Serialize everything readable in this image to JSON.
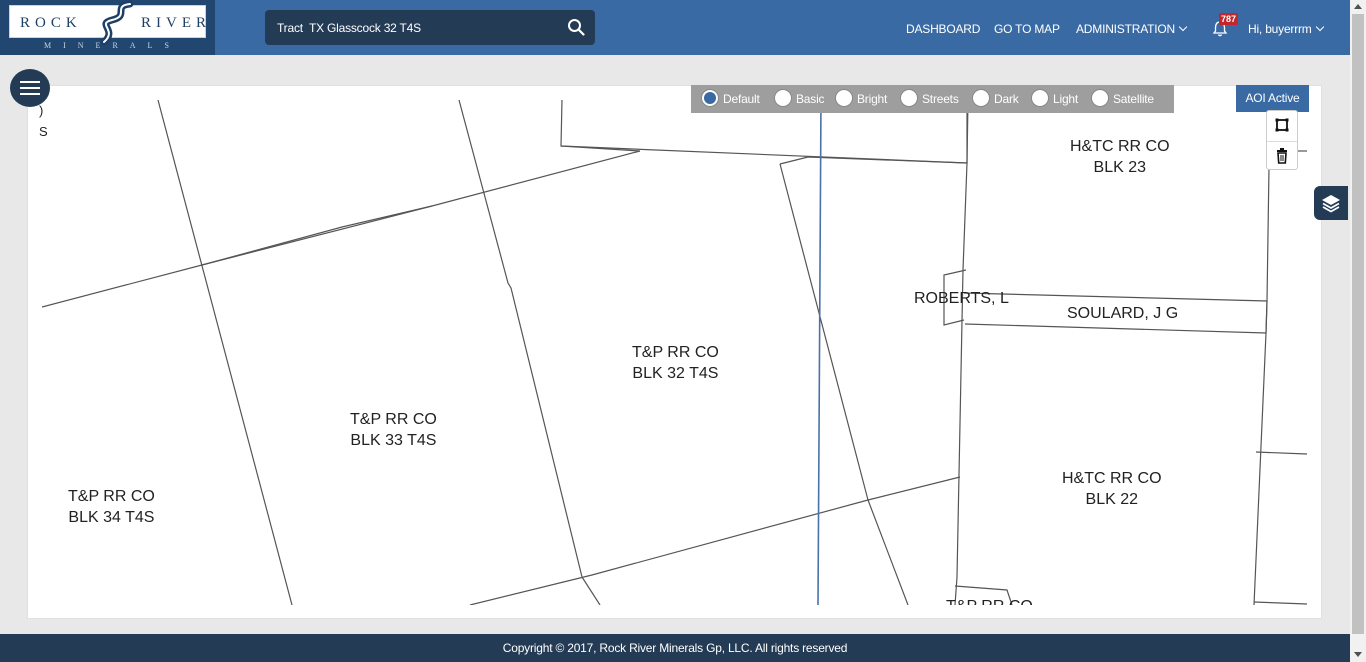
{
  "logo": {
    "word_left": "ROCK",
    "word_right": "RIVER",
    "tagline": "MINERALS"
  },
  "search": {
    "value": "Tract  TX Glasscock 32 T4S",
    "icon": "search-icon"
  },
  "nav": {
    "dashboard": "DASHBOARD",
    "go_to_map": "GO TO MAP",
    "administration": "ADMINISTRATION",
    "notifications_count": "787",
    "user_greeting": "Hi, buyerrrm"
  },
  "basemaps": {
    "selected": "Default",
    "options": [
      "Default",
      "Basic",
      "Bright",
      "Streets",
      "Dark",
      "Light",
      "Satellite"
    ]
  },
  "aoi_label": "AOI Active",
  "map": {
    "edge_fragments": [
      ")",
      "S"
    ],
    "labels": [
      {
        "line1": "H&TC RR CO",
        "line2": "BLK 23"
      },
      {
        "line1": "ROBERTS, L",
        "line2": ""
      },
      {
        "line1": "SOULARD, J G",
        "line2": ""
      },
      {
        "line1": "T&P RR CO",
        "line2": "BLK 32 T4S"
      },
      {
        "line1": "T&P RR CO",
        "line2": "BLK 33 T4S"
      },
      {
        "line1": "T&P RR CO",
        "line2": "BLK 34 T4S"
      },
      {
        "line1": "H&TC RR CO",
        "line2": "BLK 22"
      },
      {
        "line1": "T&P RR CO",
        "line2": ""
      }
    ]
  },
  "colors": {
    "header": "#3a6aa3",
    "logo_bg": "#21466f",
    "dark_navy": "#243b55",
    "basemap_bar": "#9e9e9e",
    "parcel_line": "#555555",
    "route_line": "#4a72a8"
  },
  "footer": {
    "copyright": "Copyright © 2017, Rock River Minerals Gp, LLC. All rights reserved"
  }
}
